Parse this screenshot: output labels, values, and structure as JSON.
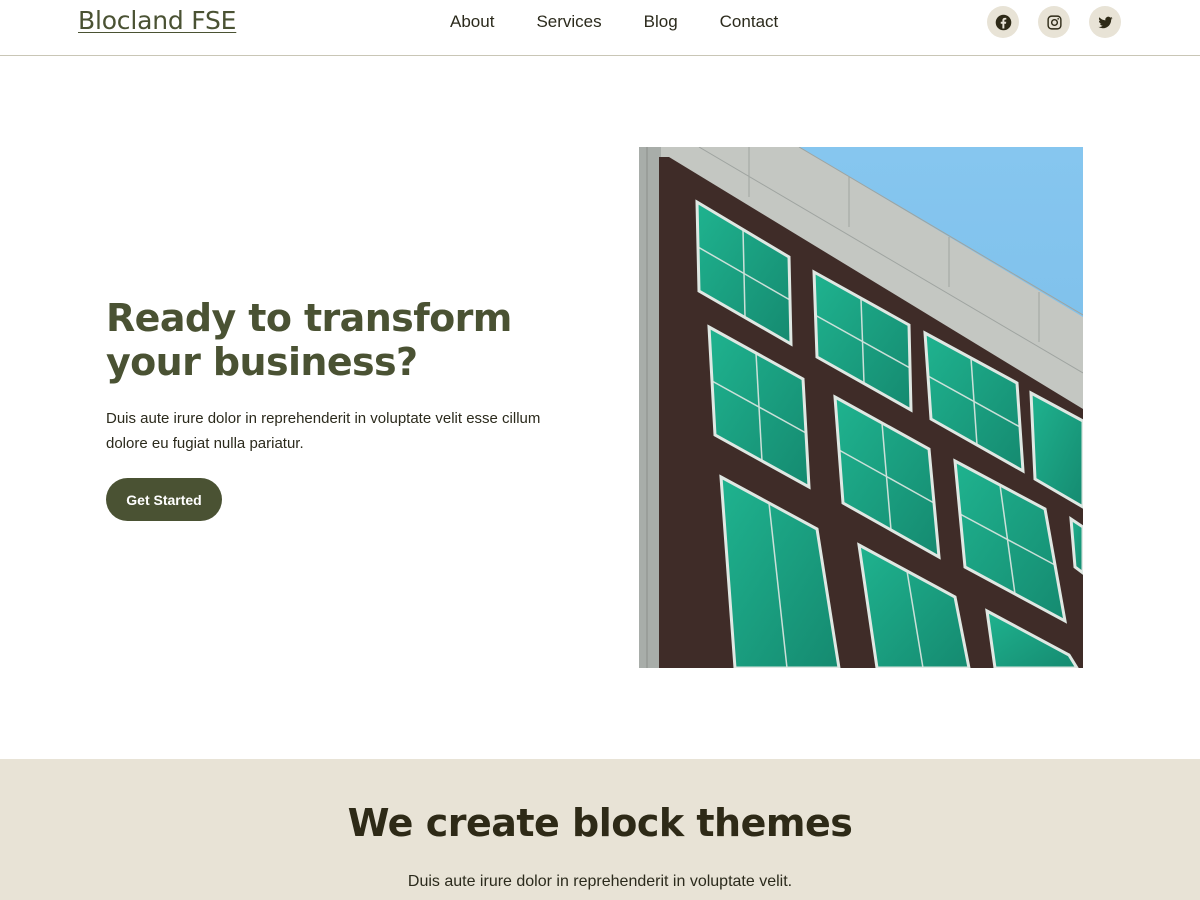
{
  "header": {
    "site_title": "Blocland FSE",
    "nav": [
      "About",
      "Services",
      "Blog",
      "Contact"
    ],
    "socials": [
      {
        "icon": "facebook-icon"
      },
      {
        "icon": "instagram-icon"
      },
      {
        "icon": "twitter-icon"
      }
    ]
  },
  "hero": {
    "heading": "Ready to transform your business?",
    "text": "Duis aute irure dolor in reprehenderit in voluptate velit esse cillum dolore eu fugiat nulla pariatur.",
    "button_label": "Get Started"
  },
  "themes_section": {
    "heading": "We create block themes",
    "text": "Duis aute irure dolor in reprehenderit in voluptate velit."
  },
  "colors": {
    "accent": "#4a5233",
    "section_bg": "#e8e3d6",
    "text": "#2b2a1c"
  }
}
